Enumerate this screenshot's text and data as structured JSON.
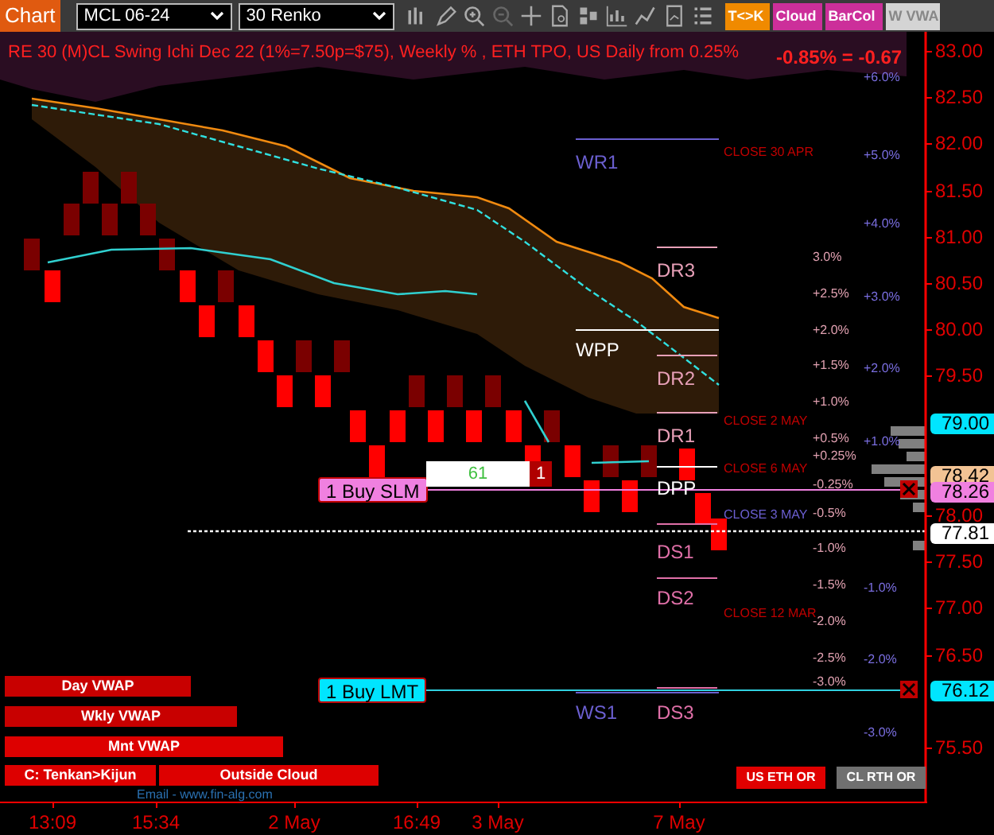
{
  "toolbar": {
    "chart_button": "Chart",
    "symbol": "MCL 06-24",
    "interval": "30 Renko",
    "study_buttons": [
      {
        "label": "T<>K",
        "color": "#f08a00"
      },
      {
        "label": "Cloud",
        "color": "#cc2f9a"
      },
      {
        "label": "BarCol",
        "color": "#cc2f9a"
      },
      {
        "label": "W VWA",
        "color": "#d4d4d4"
      }
    ]
  },
  "chart": {
    "title": "RE 30 (M)CL Swing Ichi Dec 22  (1%=7.50p=$75), Weekly % , ETH TPO, US Daily from 0.25%",
    "change": "-0.85% = -0.67",
    "price_axis": [
      "83.00",
      "82.50",
      "82.00",
      "81.50",
      "81.00",
      "80.50",
      "80.00",
      "79.50",
      "78.00",
      "77.50",
      "77.00",
      "76.50",
      "75.50"
    ],
    "price_markers": [
      {
        "label": "79.00",
        "color": "#00e5ff"
      },
      {
        "label": "78.42",
        "color": "#f2c394"
      },
      {
        "label": "78.26",
        "color": "#f080e0"
      },
      {
        "label": "77.81",
        "color": "#ffffff"
      },
      {
        "label": "76.12",
        "color": "#00e5ff"
      }
    ],
    "pivot_levels": [
      {
        "label": "WR1",
        "color": "#6b5fd0"
      },
      {
        "label": "DR3",
        "color": "#e8a0b8"
      },
      {
        "label": "WPP",
        "color": "#ffffff"
      },
      {
        "label": "DR2",
        "color": "#e8a0b8"
      },
      {
        "label": "DR1",
        "color": "#e8a0b8"
      },
      {
        "label": "DPP",
        "color": "#ffffff"
      },
      {
        "label": "DS1",
        "color": "#e070a8"
      },
      {
        "label": "DS2",
        "color": "#e070a8"
      },
      {
        "label": "WS1",
        "color": "#6b5fd0"
      },
      {
        "label": "DS3",
        "color": "#e070a8"
      }
    ],
    "close_labels": [
      {
        "label": "CLOSE 30 APR",
        "color": "#c00000"
      },
      {
        "label": "CLOSE 2 MAY",
        "color": "#c00000"
      },
      {
        "label": "CLOSE 6 MAY",
        "color": "#c00000"
      },
      {
        "label": "CLOSE 3 MAY",
        "color": "#6b5fd0"
      },
      {
        "label": "CLOSE 12 MAR",
        "color": "#c00000"
      }
    ],
    "daily_percents": [
      "3.0%",
      "+2.5%",
      "+2.0%",
      "+1.5%",
      "+1.0%",
      "+0.5%",
      "+0.25%",
      "-0.25%",
      "-0.5%",
      "-1.0%",
      "-1.5%",
      "-2.0%",
      "-2.5%",
      "-3.0%"
    ],
    "weekly_percents": [
      "+6.0%",
      "+5.0%",
      "+4.0%",
      "+3.0%",
      "+2.0%",
      "+1.0%",
      "-1.0%",
      "-2.0%",
      "-3.0%"
    ],
    "orders": [
      {
        "label": "1 Buy SLM",
        "color": "#f080e0"
      },
      {
        "label": "1 Buy LMT",
        "color": "#00e5ff"
      }
    ],
    "position": {
      "quantity": "61",
      "count": "1"
    },
    "indicator_bars": [
      "Day VWAP",
      "Wkly VWAP",
      "Mnt VWAP",
      "C: Tenkan>Kijun",
      "Outside Cloud"
    ],
    "footer_link": "Email - www.fin-alg.com",
    "status_buttons": [
      {
        "label": "US ETH OR",
        "color": "#e00000"
      },
      {
        "label": "CL RTH OR",
        "color": "#707070"
      }
    ],
    "time_axis": [
      "13:09",
      "15:34",
      "2 May",
      "16:49",
      "3 May",
      "7 May"
    ]
  }
}
